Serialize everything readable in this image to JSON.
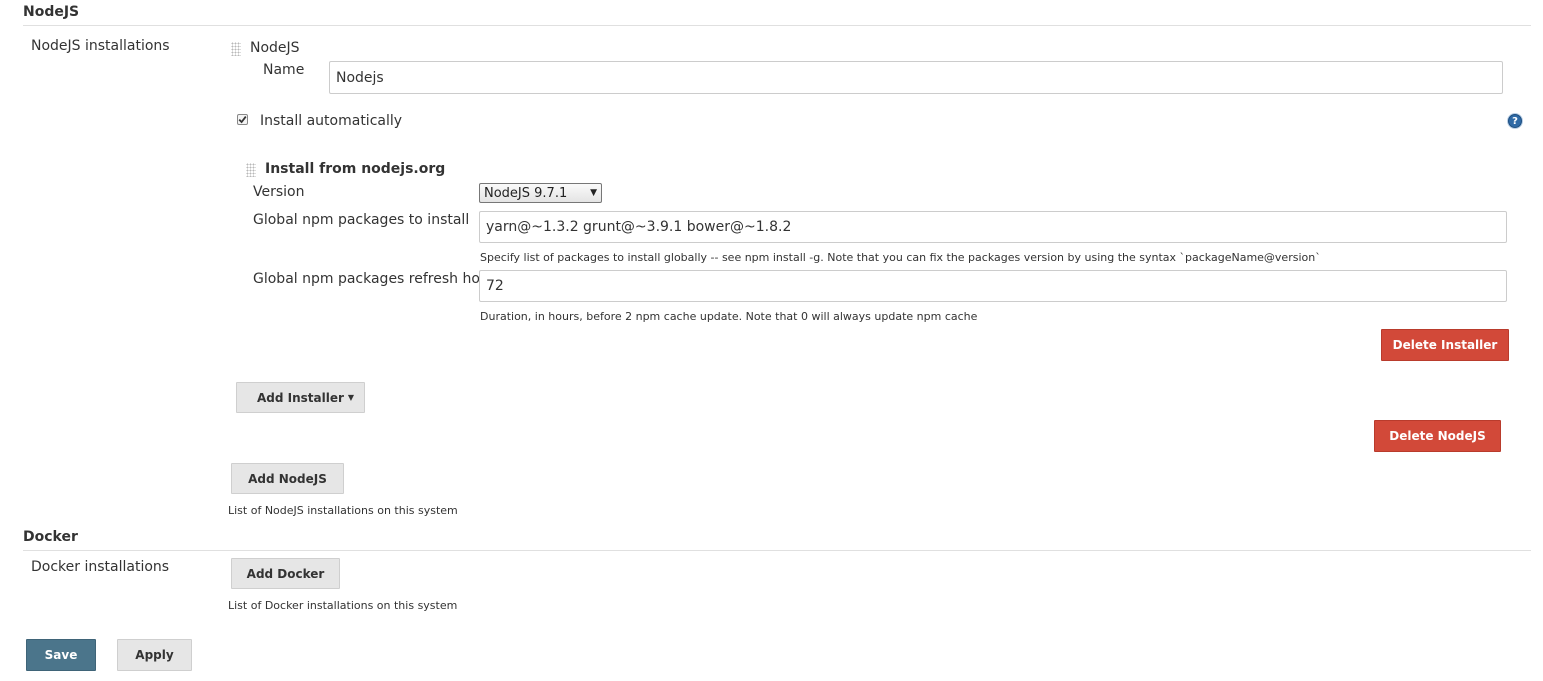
{
  "nodejs_section": {
    "title": "NodeJS",
    "installations_label": "NodeJS installations",
    "installation": {
      "header": "NodeJS",
      "name_label": "Name",
      "name_value": "Nodejs",
      "install_automatically_label": "Install automatically",
      "install_automatically_checked": true,
      "help_icon": "?",
      "installer": {
        "header": "Install from nodejs.org",
        "version_label": "Version",
        "version_value": "NodeJS 9.7.1",
        "global_packages_label": "Global npm packages to install",
        "global_packages_value": "yarn@~1.3.2 grunt@~3.9.1 bower@~1.8.2",
        "global_packages_help": "Specify list of packages to install globally -- see npm install -g. Note that you can fix the packages version by using the syntax `packageName@version`",
        "refresh_hours_label": "Global npm packages refresh hours",
        "refresh_hours_value": "72",
        "refresh_hours_help": "Duration, in hours, before 2 npm cache update. Note that 0 will always update npm cache",
        "delete_installer_label": "Delete Installer"
      },
      "add_installer_label": "Add Installer",
      "delete_nodejs_label": "Delete NodeJS"
    },
    "add_nodejs_label": "Add NodeJS",
    "list_help": "List of NodeJS installations on this system"
  },
  "docker_section": {
    "title": "Docker",
    "installations_label": "Docker installations",
    "add_docker_label": "Add Docker",
    "list_help": "List of Docker installations on this system"
  },
  "footer": {
    "save_label": "Save",
    "apply_label": "Apply"
  },
  "colors": {
    "danger": "#d24939",
    "primary": "#4b758b",
    "neutral": "#e6e6e6"
  }
}
